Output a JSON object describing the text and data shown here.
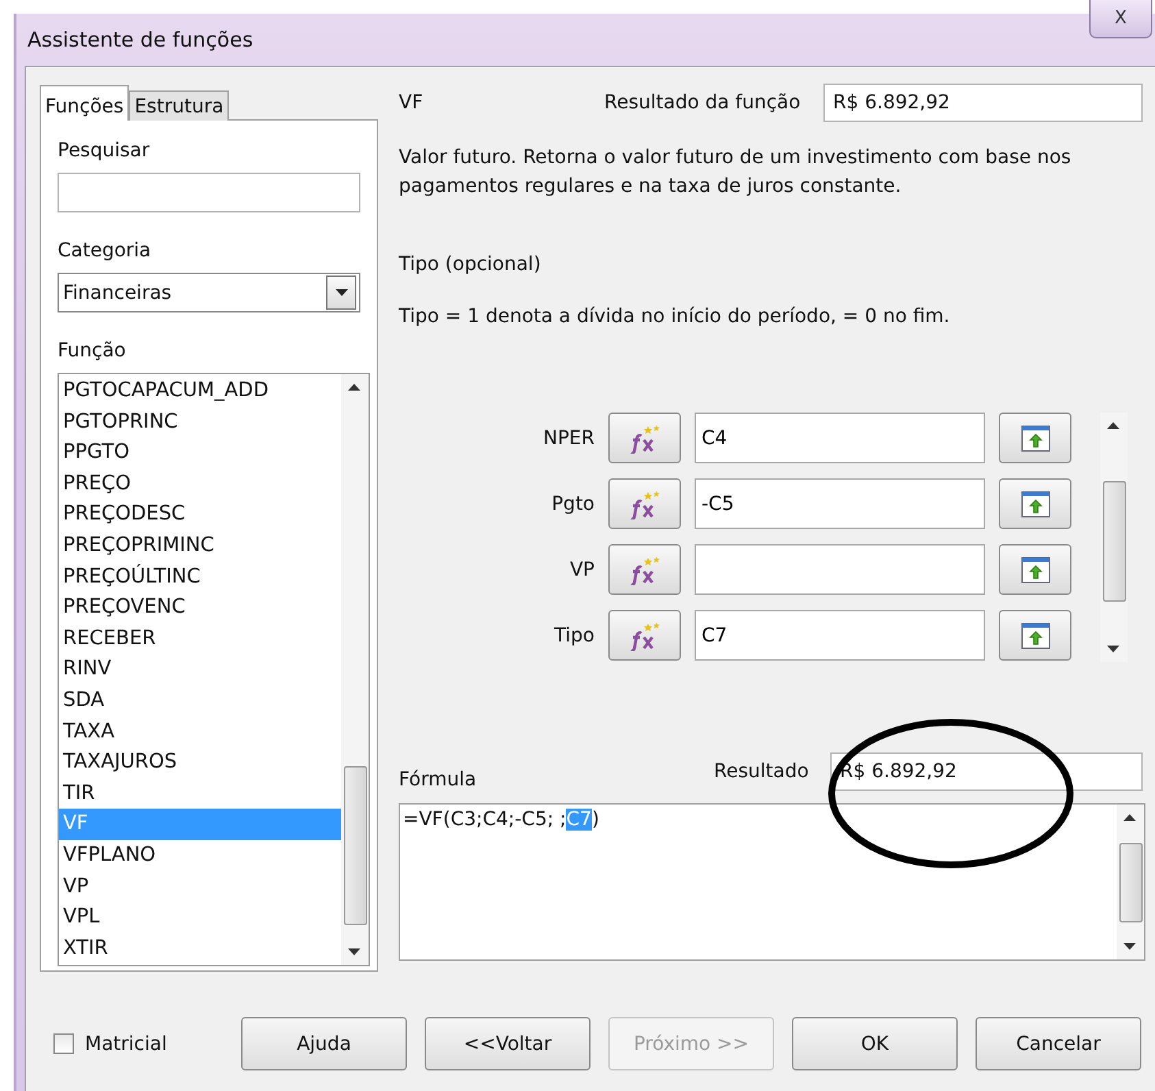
{
  "window": {
    "title": "Assistente de funções",
    "close": "X"
  },
  "tabs": [
    {
      "label": "Funções",
      "selected": true
    },
    {
      "label": "Estrutura",
      "selected": false
    }
  ],
  "search": {
    "label": "Pesquisar"
  },
  "category": {
    "label": "Categoria",
    "value": "Financeiras"
  },
  "function_list": {
    "label": "Função",
    "items": [
      {
        "label": "PGTOCAPACUM_ADD",
        "selected": false
      },
      {
        "label": "PGTOPRINC",
        "selected": false
      },
      {
        "label": "PPGTO",
        "selected": false
      },
      {
        "label": "PREÇO",
        "selected": false
      },
      {
        "label": "PREÇODESC",
        "selected": false
      },
      {
        "label": "PREÇOPRIMINC",
        "selected": false
      },
      {
        "label": "PREÇOÚLTINC",
        "selected": false
      },
      {
        "label": "PREÇOVENC",
        "selected": false
      },
      {
        "label": "RECEBER",
        "selected": false
      },
      {
        "label": "RINV",
        "selected": false
      },
      {
        "label": "SDA",
        "selected": false
      },
      {
        "label": "TAXA",
        "selected": false
      },
      {
        "label": "TAXAJUROS",
        "selected": false
      },
      {
        "label": "TIR",
        "selected": false
      },
      {
        "label": "VF",
        "selected": true
      },
      {
        "label": "VFPLANO",
        "selected": false
      },
      {
        "label": "VP",
        "selected": false
      },
      {
        "label": "VPL",
        "selected": false
      },
      {
        "label": "XTIR",
        "selected": false
      }
    ]
  },
  "function_name": "VF",
  "function_result": {
    "label": "Resultado da função",
    "value": "R$ 6.892,92"
  },
  "description": "Valor futuro. Retorna o valor futuro de um investimento com base nos pagamentos regulares e na taxa de juros constante.",
  "argument_title": "Tipo (opcional)",
  "argument_description": "Tipo = 1 denota a dívida no início do período, = 0 no fim.",
  "arguments": [
    {
      "label": "NPER",
      "value": "C4"
    },
    {
      "label": "Pgto",
      "value": "-C5"
    },
    {
      "label": "VP"
    },
    {
      "label": "Tipo",
      "value": "C7"
    }
  ],
  "formula": {
    "label": "Fórmula",
    "parts": [
      {
        "text": "=VF(C3;C4;-C5; ;",
        "selected": false
      },
      {
        "text": "C7",
        "selected": true
      },
      {
        "text": ")",
        "selected": false
      }
    ]
  },
  "result": {
    "label": "Resultado",
    "value": "R$ 6.892,92"
  },
  "matrix": {
    "label": "Matricial",
    "checked": false
  },
  "buttons": [
    {
      "label": "Ajuda",
      "disabled": false
    },
    {
      "label": "<<Voltar",
      "disabled": false
    },
    {
      "label": "Próximo >>",
      "disabled": true
    },
    {
      "label": "OK",
      "disabled": false
    },
    {
      "label": "Cancelar",
      "disabled": false
    }
  ]
}
